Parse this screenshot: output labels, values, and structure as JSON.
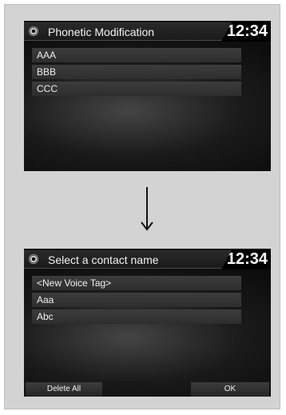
{
  "top_screen": {
    "title": "Phonetic Modification",
    "clock": "12:34",
    "items": [
      {
        "label": "AAA"
      },
      {
        "label": "BBB"
      },
      {
        "label": "CCC"
      }
    ]
  },
  "bottom_screen": {
    "title": "Select a contact name",
    "clock": "12:34",
    "items": [
      {
        "label": "<New Voice Tag>"
      },
      {
        "label": "Aaa"
      },
      {
        "label": "Abc"
      }
    ],
    "footer": {
      "delete_all_label": "Delete All",
      "ok_label": "OK"
    }
  },
  "icons": {
    "settings": "gear-icon",
    "transition": "down-arrow-icon"
  }
}
